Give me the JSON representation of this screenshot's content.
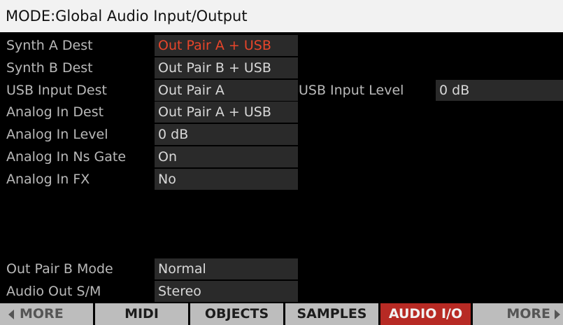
{
  "header": {
    "title": "MODE:Global Audio Input/Output"
  },
  "params": {
    "synth_a_dest": {
      "label": "Synth A Dest",
      "value": "Out Pair A + USB"
    },
    "synth_b_dest": {
      "label": "Synth B Dest",
      "value": "Out Pair B + USB"
    },
    "usb_input_dest": {
      "label": "USB Input Dest",
      "value": "Out Pair A"
    },
    "usb_input_level": {
      "label": "USB Input Level",
      "value": "0 dB"
    },
    "analog_in_dest": {
      "label": "Analog In Dest",
      "value": "Out Pair A + USB"
    },
    "analog_in_level": {
      "label": "Analog In Level",
      "value": "0 dB"
    },
    "analog_in_ns_gate": {
      "label": "Analog In Ns Gate",
      "value": "On"
    },
    "analog_in_fx": {
      "label": "Analog In FX",
      "value": "No"
    },
    "out_pair_b_mode": {
      "label": "Out Pair B Mode",
      "value": "Normal"
    },
    "audio_out_sm": {
      "label": "Audio Out S/M",
      "value": "Stereo"
    }
  },
  "tabs": {
    "more_left": "MORE",
    "midi": "MIDI",
    "objects": "OBJECTS",
    "samples": "SAMPLES",
    "audio_io": "AUDIO I/O",
    "more_right": "MORE"
  },
  "colors": {
    "selected_value": "#e8452a",
    "active_tab": "#b72a24",
    "title_bar": "#f2f2f2"
  },
  "icons": {
    "left": "triangle-left-icon",
    "right": "triangle-right-icon"
  }
}
